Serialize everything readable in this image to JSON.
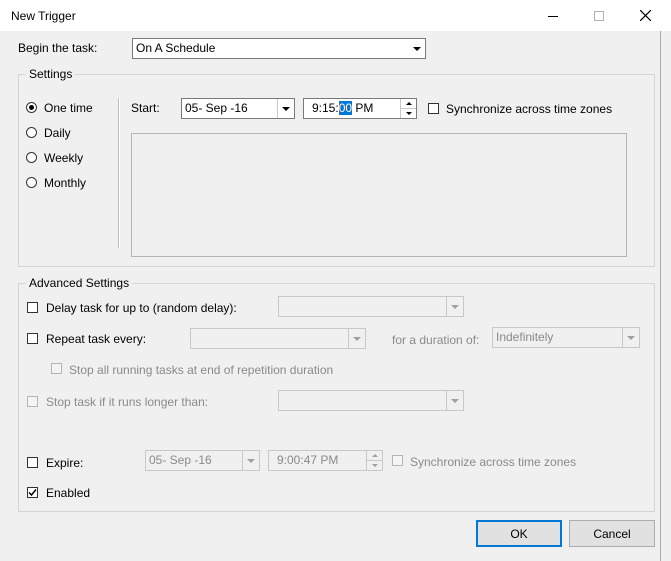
{
  "window": {
    "title": "New Trigger"
  },
  "begin_task": {
    "label": "Begin the task:",
    "value": "On A Schedule"
  },
  "settings": {
    "legend": "Settings",
    "schedule_options": [
      {
        "label": "One time",
        "selected": true
      },
      {
        "label": "Daily",
        "selected": false
      },
      {
        "label": "Weekly",
        "selected": false
      },
      {
        "label": "Monthly",
        "selected": false
      }
    ],
    "start_label": "Start:",
    "start_date": "05- Sep -16",
    "start_time_prefix": "9:15:",
    "start_time_selected": "00",
    "start_time_suffix": " PM",
    "sync_label": "Synchronize across time zones"
  },
  "advanced": {
    "legend": "Advanced Settings",
    "delay_label": "Delay task for up to (random delay):",
    "repeat_label": "Repeat task every:",
    "duration_label": "for a duration of:",
    "duration_value": "Indefinitely",
    "stop_all_label": "Stop all running tasks at end of repetition duration",
    "stop_longer_label": "Stop task if it runs longer than:",
    "expire_label": "Expire:",
    "expire_date": "05- Sep -16",
    "expire_time": "9:00:47 PM",
    "expire_sync_label": "Synchronize across time zones",
    "enabled_label": "Enabled",
    "enabled_checked": true
  },
  "buttons": {
    "ok": "OK",
    "cancel": "Cancel"
  }
}
